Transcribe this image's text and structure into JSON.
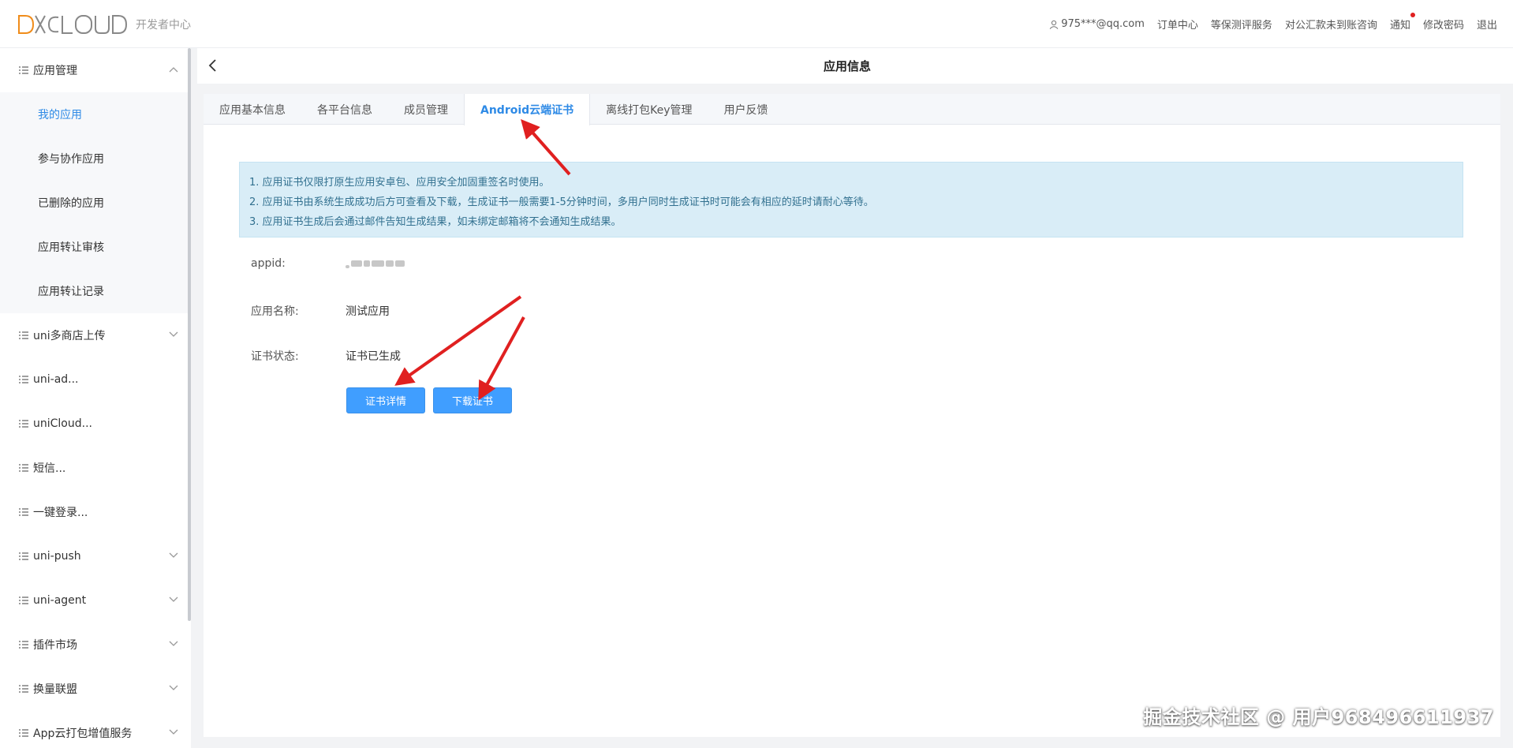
{
  "brand": {
    "logo_text": "DCLOUD",
    "subtitle": "开发者中心",
    "accent": "#f08c1a"
  },
  "topnav": {
    "user": "975***@qq.com",
    "orders": "订单中心",
    "security_service": "等保测评服务",
    "remit_consult": "对公汇款未到账咨询",
    "notify": "通知",
    "change_password": "修改密码",
    "logout": "退出"
  },
  "sidebar": {
    "app_manage": "应用管理",
    "sub": {
      "my_apps": "我的应用",
      "collab_apps": "参与协作应用",
      "deleted_apps": "已删除的应用",
      "transfer_review": "应用转让审核",
      "transfer_records": "应用转让记录"
    },
    "groups": {
      "multi_store": "uni多商店上传",
      "uni_ad": "uni-ad...",
      "unicloud": "uniCloud...",
      "sms": "短信...",
      "onekey_login": "一键登录...",
      "uni_push": "uni-push",
      "uni_agent": "uni-agent",
      "plugin_market": "插件市场",
      "exchange": "换量联盟",
      "app_pack": "App云打包增值服务"
    }
  },
  "header": {
    "title": "应用信息"
  },
  "tabs": {
    "basic": "应用基本信息",
    "platforms": "各平台信息",
    "members": "成员管理",
    "android_cert": "Android云端证书",
    "offline_key": "离线打包Key管理",
    "feedback": "用户反馈"
  },
  "notice": {
    "line1": "1. 应用证书仅限打原生应用安卓包、应用安全加固重签名时使用。",
    "line2": "2. 应用证书由系统生成成功后方可查看及下载，生成证书一般需要1-5分钟时间，多用户同时生成证书时可能会有相应的延时请耐心等待。",
    "line3": "3. 应用证书生成后会通过邮件告知生成结果，如未绑定邮箱将不会通知生成结果。"
  },
  "fields": {
    "appid_label": "appid:",
    "name_label": "应用名称:",
    "name_value": "测试应用",
    "status_label": "证书状态:",
    "status_value": "证书已生成"
  },
  "buttons": {
    "detail": "证书详情",
    "download": "下载证书"
  },
  "watermark": "掘金技术社区 @ 用户968496611937",
  "colors": {
    "primary": "#409eff",
    "active_link": "#2e8ae6",
    "annotation_arrow": "#e02020",
    "notice_bg": "#d9edf7"
  }
}
